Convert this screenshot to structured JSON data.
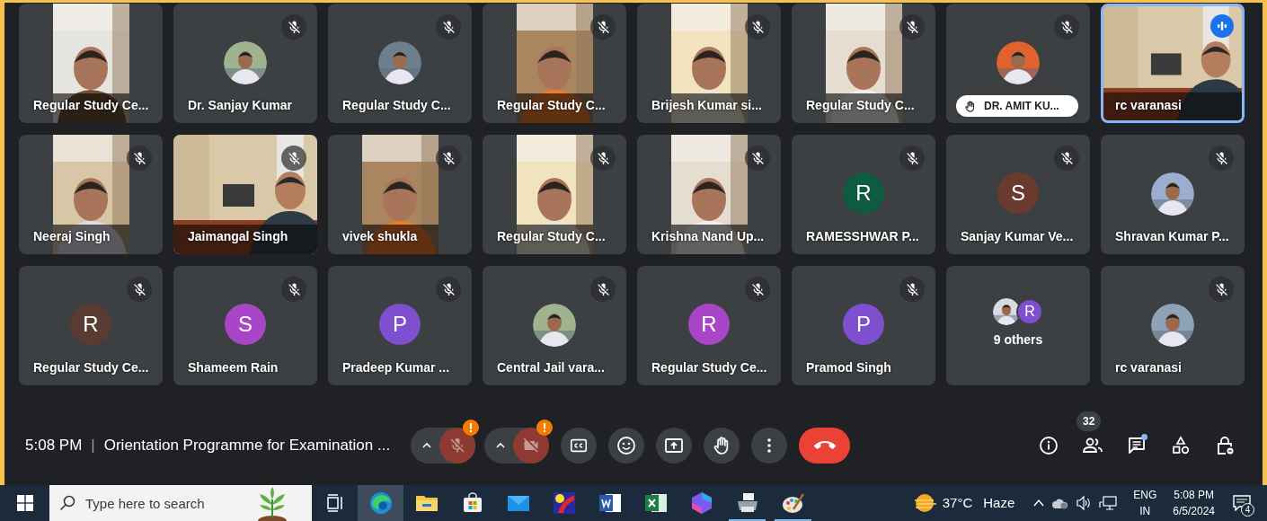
{
  "meeting": {
    "tiles": [
      {
        "kind": "video",
        "name": "Regular Study Ce...",
        "muted": false,
        "speaking": false,
        "hand_raised": false
      },
      {
        "name": "Dr. Sanjay Kumar",
        "muted": true,
        "speaking": false,
        "hand_raised": false
      },
      {
        "name": "Regular Study C...",
        "muted": true,
        "speaking": false,
        "hand_raised": false
      },
      {
        "kind": "video",
        "name": "Regular Study C...",
        "muted": true,
        "speaking": false,
        "hand_raised": false
      },
      {
        "kind": "video",
        "name": "Brijesh Kumar si...",
        "muted": true,
        "speaking": false,
        "hand_raised": false
      },
      {
        "kind": "video",
        "name": "Regular Study C...",
        "muted": true,
        "speaking": false,
        "hand_raised": false
      },
      {
        "name": "DR. AMIT KU...",
        "muted": true,
        "speaking": false,
        "hand_raised": true
      },
      {
        "kind": "video_wide",
        "name": "rc varanasi",
        "muted": false,
        "speaking": true,
        "hand_raised": false
      },
      {
        "kind": "video",
        "name": "Neeraj Singh",
        "muted": true,
        "speaking": false,
        "hand_raised": false
      },
      {
        "kind": "video_wide",
        "name": "Jaimangal Singh",
        "muted": true,
        "speaking": false,
        "hand_raised": false
      },
      {
        "kind": "video",
        "name": "vivek shukla",
        "muted": true,
        "speaking": false,
        "hand_raised": false
      },
      {
        "kind": "video",
        "name": "Regular Study C...",
        "muted": true,
        "speaking": false,
        "hand_raised": false
      },
      {
        "kind": "video",
        "name": "Krishna Nand Up...",
        "muted": true,
        "speaking": false,
        "hand_raised": false
      },
      {
        "kind": "letter",
        "initial": "R",
        "color": "#0f5b40",
        "name": "RAMESSHWAR P...",
        "muted": true,
        "speaking": false,
        "hand_raised": false
      },
      {
        "kind": "letter",
        "initial": "S",
        "color": "#6b3a2e",
        "name": "Sanjay Kumar Ve...",
        "muted": true,
        "speaking": false,
        "hand_raised": false
      },
      {
        "name": "Shravan Kumar P...",
        "muted": true,
        "speaking": false,
        "hand_raised": false
      },
      {
        "kind": "letter",
        "initial": "R",
        "color": "#5a3b32",
        "name": "Regular Study Ce...",
        "muted": true,
        "speaking": false,
        "hand_raised": false
      },
      {
        "kind": "letter",
        "initial": "S",
        "color": "#a846c7",
        "name": "Shameem Rain",
        "muted": true,
        "speaking": false,
        "hand_raised": false
      },
      {
        "kind": "letter",
        "initial": "P",
        "color": "#7e4fcf",
        "name": "Pradeep Kumar ...",
        "muted": true,
        "speaking": false,
        "hand_raised": false
      },
      {
        "name": "Central Jail vara...",
        "muted": true,
        "speaking": false,
        "hand_raised": false
      },
      {
        "kind": "letter",
        "initial": "R",
        "color": "#a846c7",
        "name": "Regular Study Ce...",
        "muted": true,
        "speaking": false,
        "hand_raised": false
      },
      {
        "kind": "letter",
        "initial": "P",
        "color": "#7e4fcf",
        "name": "Pramod Singh",
        "muted": true,
        "speaking": false,
        "hand_raised": false
      },
      {
        "kind": "others",
        "initial": "R",
        "color": "#7e4fcf",
        "label": "9 others",
        "muted": false,
        "speaking": false,
        "hand_raised": false
      },
      {
        "name": "rc varanasi",
        "muted": true,
        "speaking": false,
        "hand_raised": false
      }
    ]
  },
  "call_bar": {
    "time": "5:08 PM",
    "separator": "|",
    "title": "Orientation Programme for Examination ...",
    "controls": [
      {
        "kind": "mic",
        "off": true,
        "warning": true
      },
      {
        "kind": "camera",
        "off": true,
        "warning": true
      },
      {
        "kind": "captions"
      },
      {
        "kind": "emoji"
      },
      {
        "kind": "present"
      },
      {
        "kind": "raise_hand"
      },
      {
        "kind": "more"
      },
      {
        "kind": "end_call"
      }
    ],
    "side_buttons": [
      {
        "kind": "info"
      },
      {
        "kind": "people",
        "badge": "32"
      },
      {
        "kind": "chat",
        "unread": true
      },
      {
        "kind": "activities"
      },
      {
        "kind": "host_controls"
      }
    ]
  },
  "taskbar": {
    "search": {
      "placeholder": "Type here to search"
    },
    "apps": [
      {
        "kind": "task_view",
        "active": false,
        "running": false
      },
      {
        "kind": "edge",
        "active": true,
        "running": false
      },
      {
        "kind": "explorer",
        "active": false,
        "running": false
      },
      {
        "kind": "store",
        "active": false,
        "running": false
      },
      {
        "kind": "mail",
        "active": false,
        "running": false
      },
      {
        "kind": "paint_app",
        "active": false,
        "running": false
      },
      {
        "kind": "word",
        "active": false,
        "running": false
      },
      {
        "kind": "excel",
        "active": false,
        "running": false
      },
      {
        "kind": "copilot",
        "active": false,
        "running": false
      },
      {
        "kind": "printer",
        "active": false,
        "running": true
      },
      {
        "kind": "palette",
        "active": false,
        "running": true
      }
    ],
    "weather": {
      "temperature": "37°C",
      "condition": "Haze"
    },
    "language": {
      "line_1": "ENG",
      "line_2": "IN"
    },
    "clock": {
      "time": "5:08 PM",
      "date": "6/5/2024"
    },
    "notifications": "4"
  }
}
